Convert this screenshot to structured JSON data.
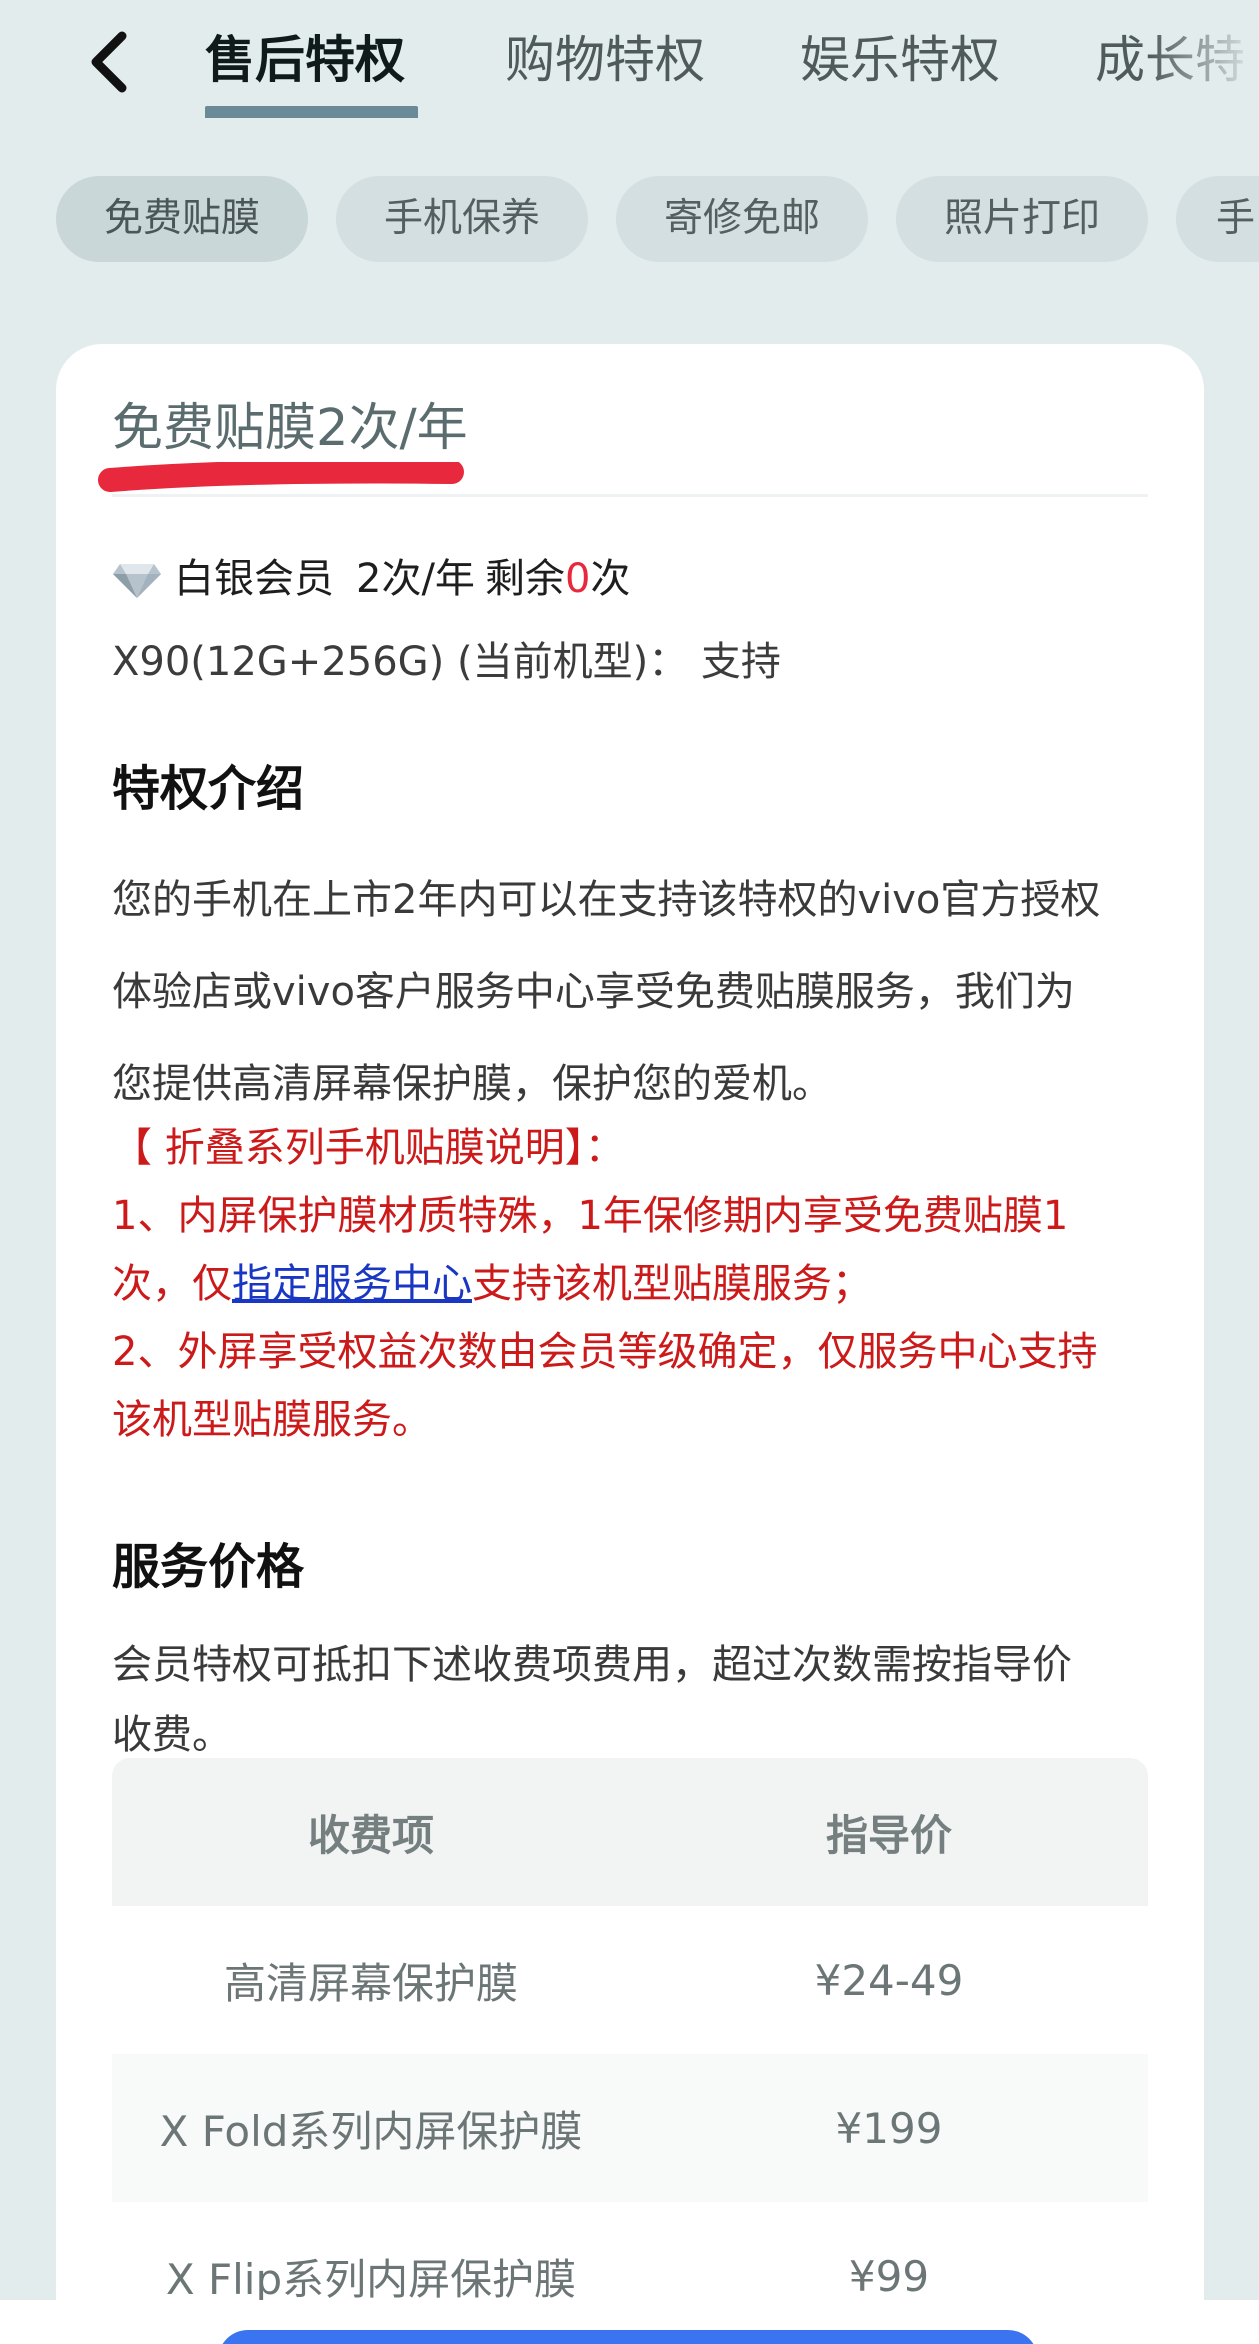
{
  "header": {
    "tabs": [
      {
        "label": "售后特权",
        "active": true
      },
      {
        "label": "购物特权",
        "active": false
      },
      {
        "label": "娱乐特权",
        "active": false
      },
      {
        "label": "成长特",
        "active": false
      }
    ]
  },
  "chips": [
    {
      "label": "免费贴膜",
      "active": true
    },
    {
      "label": "手机保养",
      "active": false
    },
    {
      "label": "寄修免邮",
      "active": false
    },
    {
      "label": "照片打印",
      "active": false
    },
    {
      "label": "手",
      "active": false
    }
  ],
  "card": {
    "title": "免费贴膜2次/年",
    "member": {
      "level": "白银会员",
      "quota": "2次/年",
      "remaining_prefix": "剩余",
      "remaining_count": "0",
      "remaining_suffix": "次"
    },
    "model_line": "X90(12G+256G) (当前机型)： 支持",
    "intro_heading": "特权介绍",
    "intro_lines": [
      "您的手机在上市2年内可以在支持该特权的vivo官方授权",
      "体验店或vivo客户服务中心享受免费贴膜服务，我们为",
      "您提供高清屏幕保护膜，保护您的爱机。"
    ],
    "fold_note": {
      "heading": "【 折叠系列手机贴膜说明】：",
      "line1": "1、内屏保护膜材质特殊，1年保修期内享受免费贴膜1",
      "line2_prefix": "次，仅",
      "line2_link": "指定服务中心",
      "line2_suffix": "支持该机型贴膜服务；",
      "line3": "2、外屏享受权益次数由会员等级确定，仅服务中心支持",
      "line4": "该机型贴膜服务。"
    },
    "price_heading": "服务价格",
    "price_desc_lines": [
      "会员特权可抵扣下述收费项费用，超过次数需按指导价",
      "收费。"
    ],
    "price_table": {
      "headers": [
        "收费项",
        "指导价"
      ],
      "rows": [
        [
          "高清屏幕保护膜",
          "¥24-49"
        ],
        [
          "X Fold系列内屏保护膜",
          "¥199"
        ],
        [
          "X Flip系列内屏保护膜",
          "¥99"
        ]
      ]
    }
  },
  "colors": {
    "highlight_red": "#e8283c",
    "note_red": "#cc1a1a",
    "link_blue": "#1a37c4",
    "tab_underline": "#6b8a98"
  }
}
